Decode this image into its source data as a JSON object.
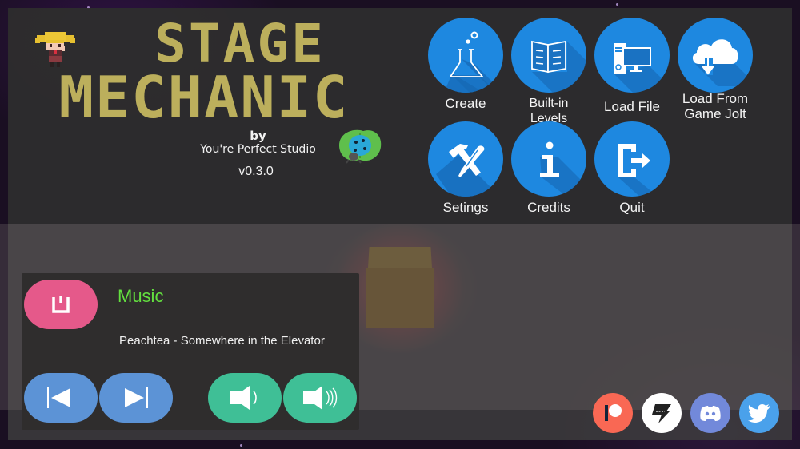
{
  "logo": {
    "title_line1": "STAGE",
    "title_line2": "MECHANIC",
    "by": "by",
    "studio": "You're Perfect Studio",
    "version": "v0.3.0",
    "mascot_icon": "pixel-girl-mascot",
    "studio_icon": "ladybug-on-leaf"
  },
  "menu": {
    "accent": "#1e88e0",
    "items": [
      {
        "label": "Create",
        "icon": "flask-icon"
      },
      {
        "label": "Built-in Levels",
        "icon": "book-icon"
      },
      {
        "label": "Load File",
        "icon": "computer-icon"
      },
      {
        "label": "Load From Game Jolt",
        "icon": "cloud-download-icon"
      },
      {
        "label": "Setings",
        "icon": "hammer-screwdriver-icon"
      },
      {
        "label": "Credits",
        "icon": "info-icon"
      },
      {
        "label": "Quit",
        "icon": "exit-icon"
      }
    ]
  },
  "music": {
    "label": "Music",
    "track": "Peachtea - Somewhere in the Elevator",
    "colors": {
      "label": "#63e03f",
      "toggle": "#e5598a",
      "nav": "#5c93d6",
      "volume": "#3fbf96"
    },
    "buttons": {
      "toggle": "power-toggle-icon",
      "previous": "previous-track-icon",
      "next": "next-track-icon",
      "volume_down": "volume-down-icon",
      "volume_up": "volume-up-icon"
    }
  },
  "social": [
    {
      "name": "Patreon",
      "icon": "patreon-icon",
      "color": "#f96854"
    },
    {
      "name": "Game Jolt",
      "icon": "gamejolt-icon",
      "color": "#ffffff"
    },
    {
      "name": "Discord",
      "icon": "discord-icon",
      "color": "#7289da"
    },
    {
      "name": "Twitter",
      "icon": "twitter-icon",
      "color": "#4aa1eb"
    }
  ]
}
